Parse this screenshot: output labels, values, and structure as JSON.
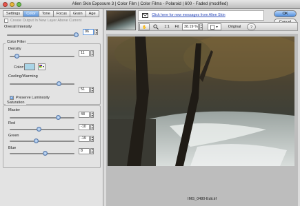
{
  "window": {
    "title": "Alien Skin Exposure 3 | Color Film | Color Films - Polaroid | 600 - Faded (modified)"
  },
  "tabs": [
    {
      "label": "Settings"
    },
    {
      "label": "Color"
    },
    {
      "label": "Tone"
    },
    {
      "label": "Focus"
    },
    {
      "label": "Grain"
    },
    {
      "label": "Age"
    }
  ],
  "left_panel": {
    "create_output_label": "Create Output In New Layer Above Current",
    "overall_intensity": {
      "label": "Overall Intensity",
      "value": "96"
    },
    "color_filter": {
      "title": "Color Filter",
      "density": {
        "label": "Density",
        "value": "11"
      },
      "color_label": "Color:",
      "cooling_warming": {
        "label": "Cooling/Warming",
        "value": "51"
      },
      "preserve_luminosity": {
        "label": "Preserve Luminosity",
        "checked": true
      }
    },
    "saturation": {
      "title": "Saturation",
      "master": {
        "label": "Master",
        "value": "48"
      },
      "red": {
        "label": "Red",
        "value": "-10"
      },
      "green": {
        "label": "Green",
        "value": "-19"
      },
      "blue": {
        "label": "Blue",
        "value": "8"
      }
    }
  },
  "right_panel": {
    "info_link": "Click here for new messages from Alien Skin",
    "ok_label": "OK",
    "cancel_label": "Cancel",
    "toolbar": {
      "zoom_1to1": "1:1",
      "fit_label": "Fit",
      "zoom_value": "38.19 %",
      "original_label": "Original",
      "help_label": "?"
    },
    "filename": "IMG_0480-Edit.tif"
  },
  "colors": {
    "accent": "#5d95dc",
    "swatch": "#a9d4e6",
    "link": "#2a48b8"
  }
}
